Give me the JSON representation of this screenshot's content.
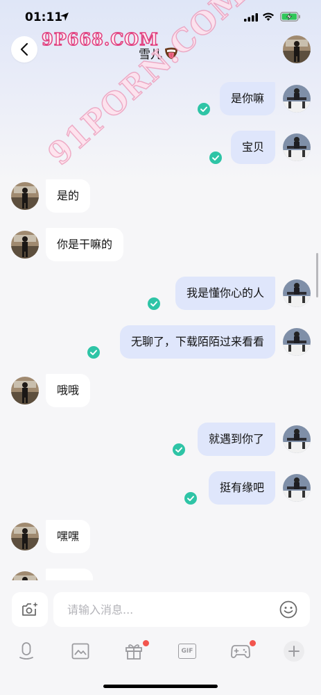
{
  "status_bar": {
    "time": "01:11"
  },
  "header": {
    "title": "雪儿",
    "title_emoji": "tongue-emoji",
    "watermark": "9P668.COM"
  },
  "watermark_diagonal": "91PORN.COM",
  "messages": [
    {
      "direction": "out",
      "text": "是你嘛",
      "read": true
    },
    {
      "direction": "out",
      "text": "宝贝",
      "read": true
    },
    {
      "direction": "in",
      "text": "是的"
    },
    {
      "direction": "in",
      "text": "你是干嘛的"
    },
    {
      "direction": "out",
      "text": "我是懂你心的人",
      "read": true
    },
    {
      "direction": "out",
      "text": "无聊了，下载陌陌过来看看",
      "read": true
    },
    {
      "direction": "in",
      "text": "哦哦"
    },
    {
      "direction": "out",
      "text": "就遇到你了",
      "read": true
    },
    {
      "direction": "out",
      "text": "挺有缘吧",
      "read": true
    },
    {
      "direction": "in",
      "text": "嘿嘿"
    }
  ],
  "composer": {
    "placeholder": "请输入消息..."
  },
  "toolbar": {
    "items": [
      "mic-icon",
      "image-icon",
      "gift-icon",
      "gif-icon",
      "gamepad-icon",
      "plus-icon"
    ],
    "gif_label": "GIF"
  },
  "colors": {
    "outgoing_bubble": "#dfe6fb",
    "incoming_bubble": "#ffffff",
    "read_check": "#2ec4a6",
    "badge": "#f2554e"
  }
}
